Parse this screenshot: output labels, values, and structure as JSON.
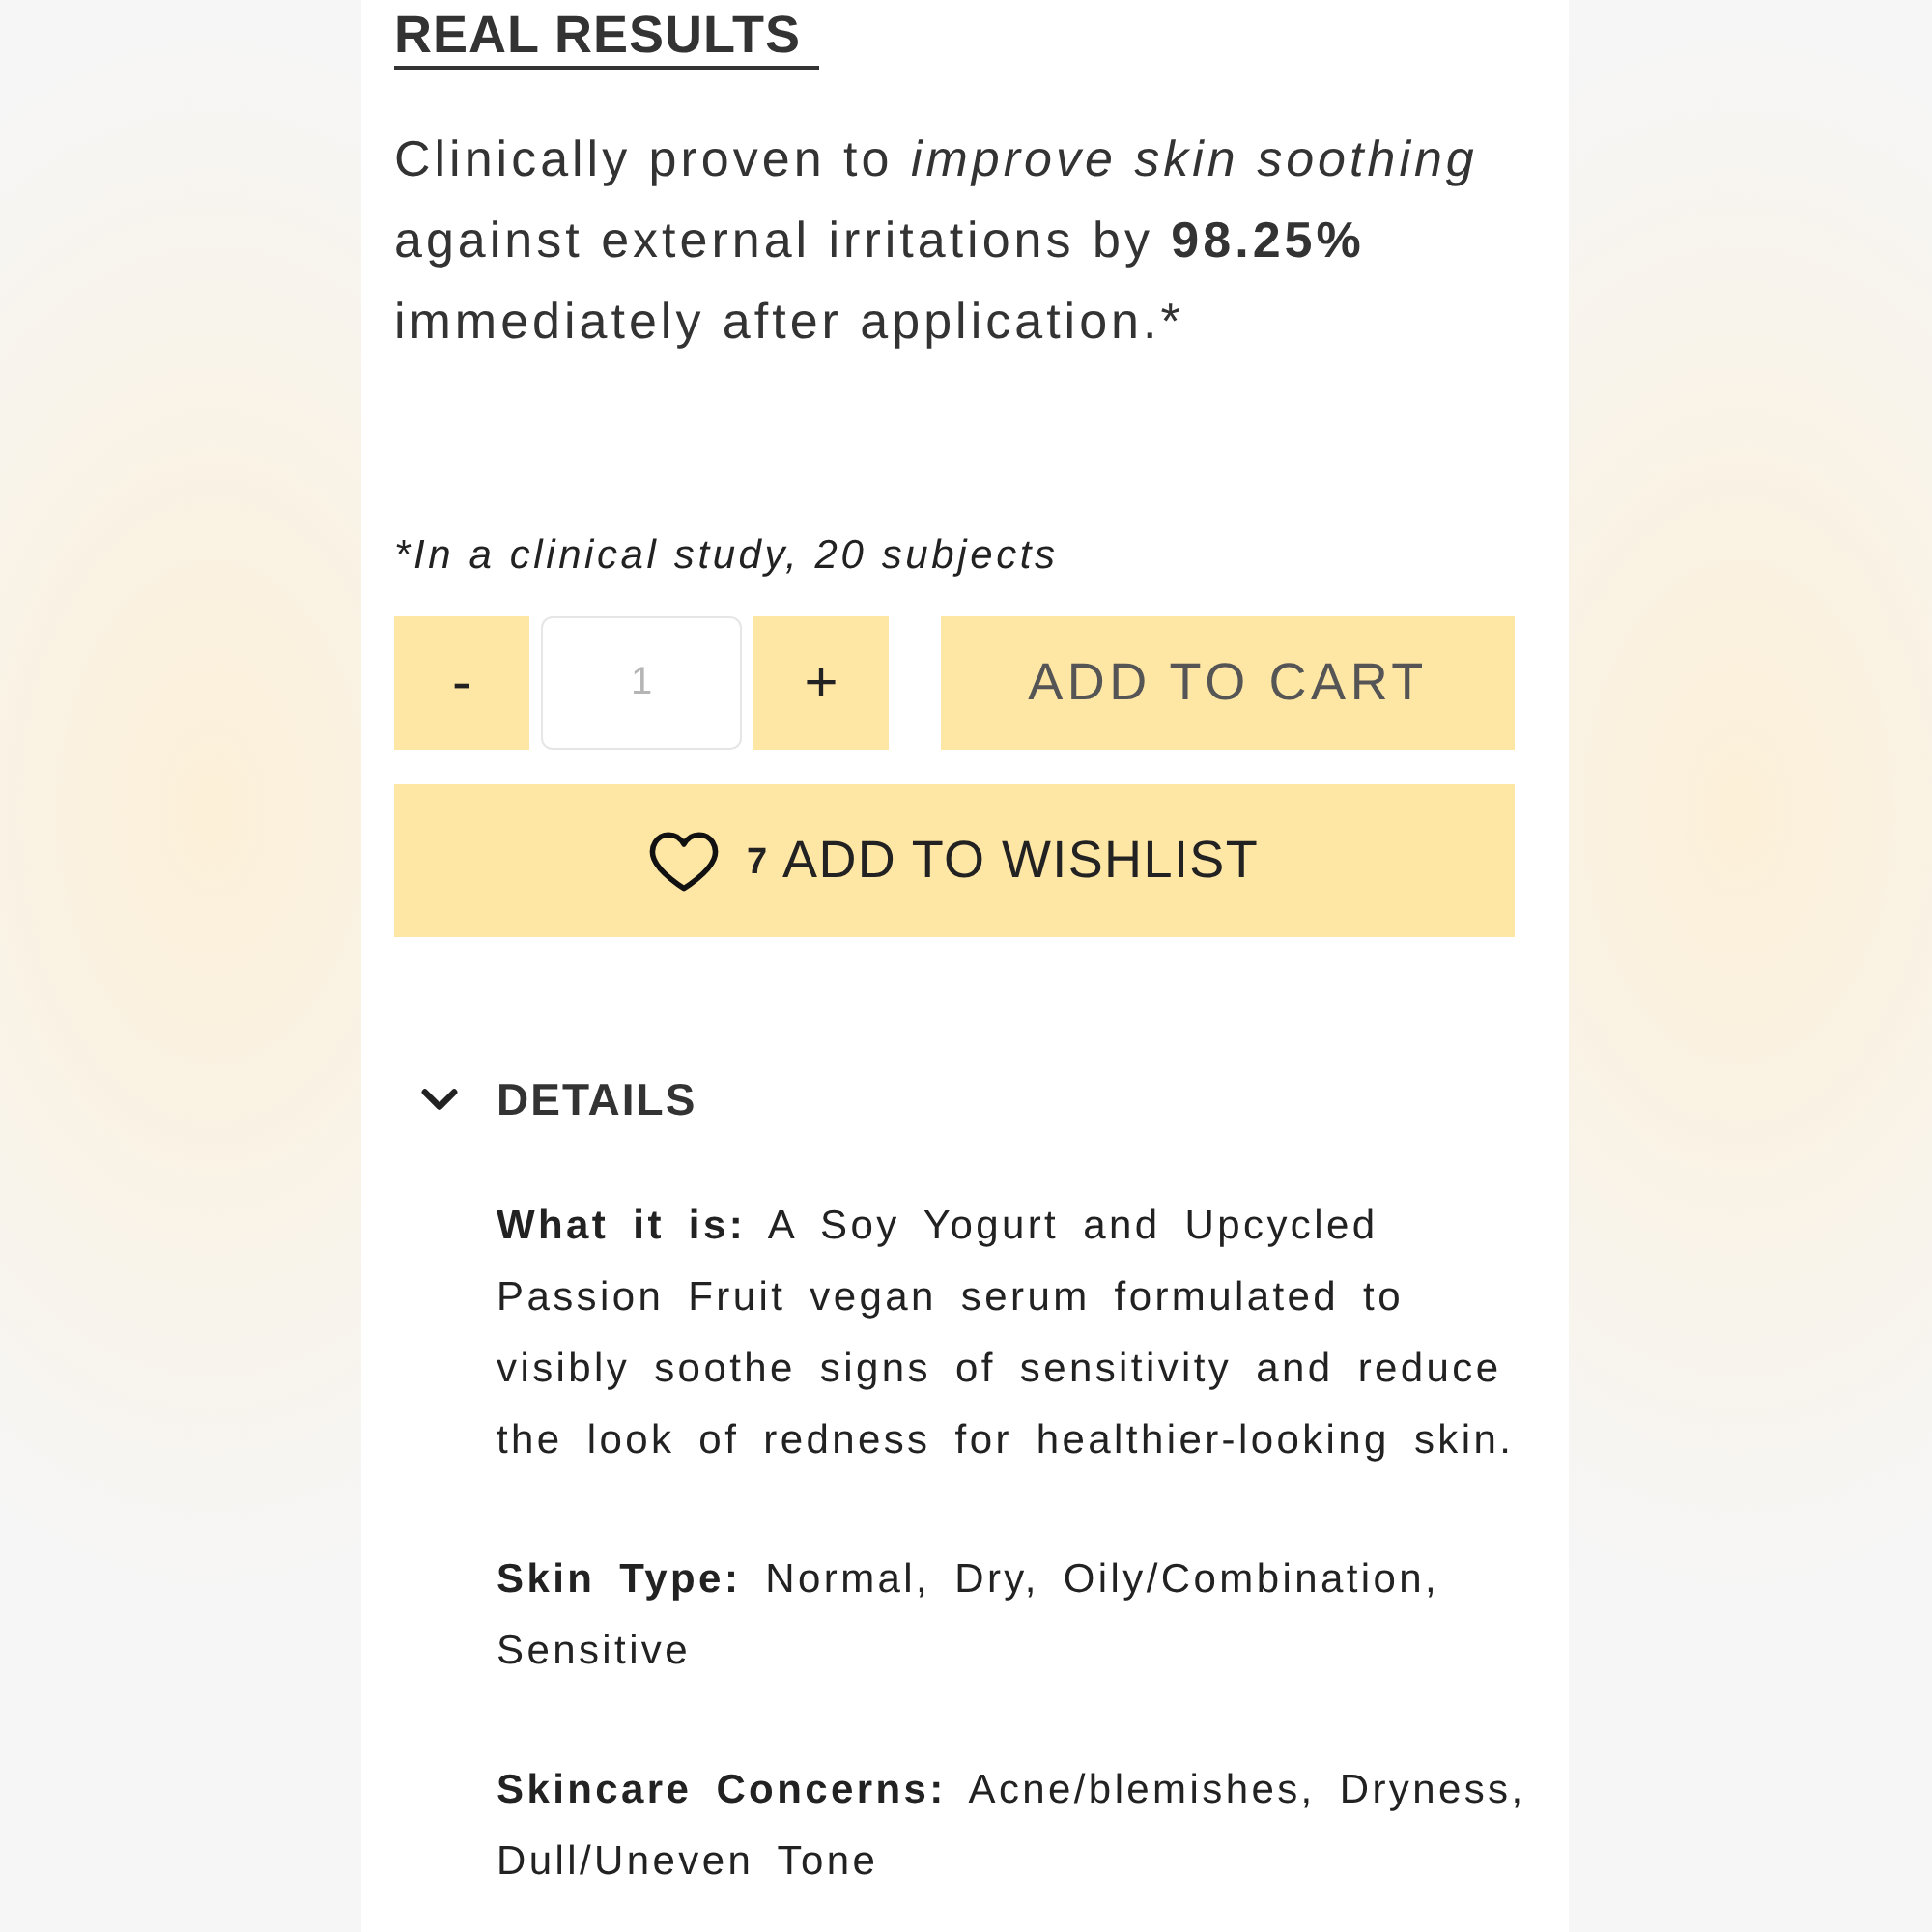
{
  "real_results": {
    "heading": "REAL RESULTS",
    "text": "Clinically proven to *improve skin soothing* against external irritations by **98.25%** immediately after application.*"
  },
  "footnote": "*In a clinical study, 20 subjects",
  "purchase": {
    "decrement": "-",
    "quantity": {
      "placeholder": "1"
    },
    "increment": "+",
    "add_to_cart": "ADD TO CART"
  },
  "wishlist": {
    "count": "7",
    "label": "ADD TO WISHLIST"
  },
  "details": {
    "title": "DETAILS",
    "expanded": true,
    "items": [
      "**What it is:** A Soy Yogurt and Upcycled Passion Fruit vegan serum formulated to visibly soothe signs of sensitivity and reduce the look of redness for healthier-looking skin.",
      "**Skin Type:** Normal, Dry, Oily/Combination, Sensitive",
      "**Skincare Concerns:** Acne/blemishes, Dryness, Dull/Uneven Tone"
    ]
  }
}
